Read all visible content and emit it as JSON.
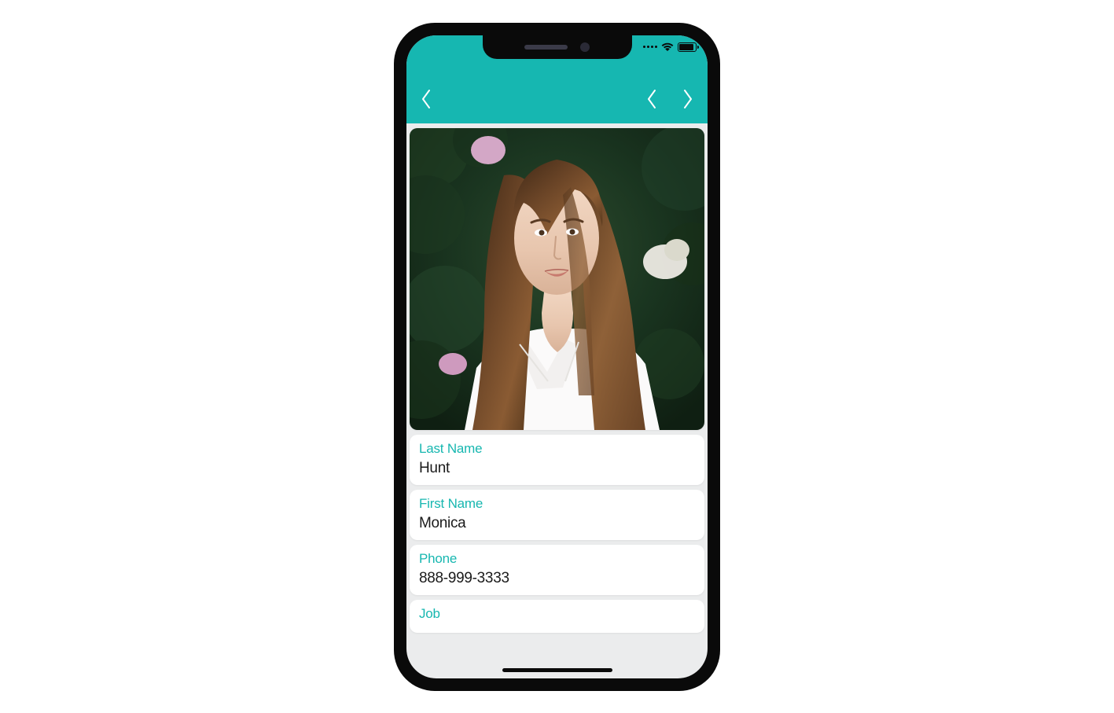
{
  "colors": {
    "accent": "#16b7b1",
    "labelColor": "#17b7b0"
  },
  "nav": {
    "back_icon": "chevron-left",
    "prev_icon": "chevron-left",
    "next_icon": "chevron-right"
  },
  "photo": {
    "description": "Portrait of a young woman with long brown hair, white collared shirt, green foliage and pink-white flowers in background"
  },
  "fields": [
    {
      "label": "Last Name",
      "value": "Hunt"
    },
    {
      "label": "First Name",
      "value": "Monica"
    },
    {
      "label": "Phone",
      "value": "888-999-3333"
    },
    {
      "label": "Job",
      "value": ""
    }
  ]
}
